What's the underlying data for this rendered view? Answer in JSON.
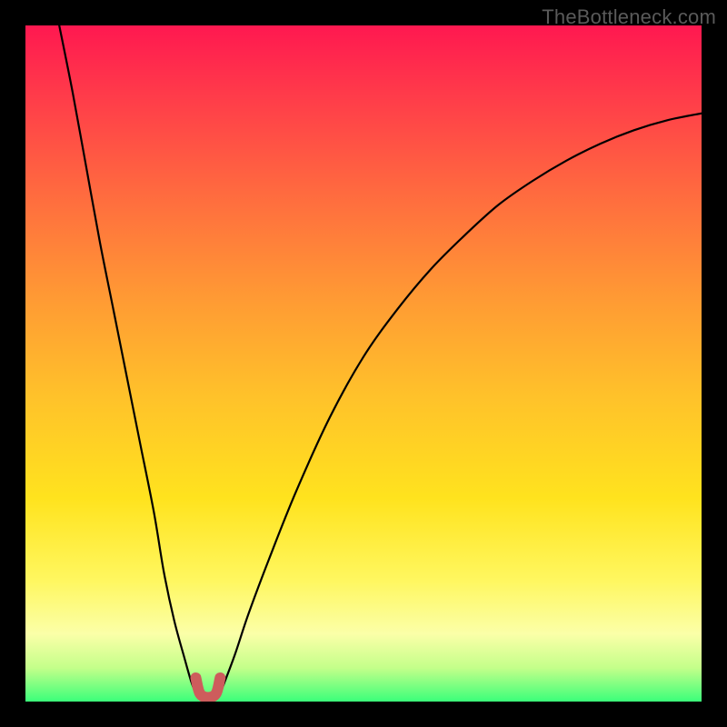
{
  "watermark": "TheBottleneck.com",
  "palette": {
    "frame": "#000000",
    "curve_stroke": "#000000",
    "marker_stroke": "#cd5c5c",
    "gradient_top": "#ff1850",
    "gradient_bottom": "#3bff7a"
  },
  "chart_data": {
    "type": "line",
    "title": "",
    "xlabel": "",
    "ylabel": "",
    "xlim": [
      0,
      100
    ],
    "ylim": [
      0,
      100
    ],
    "series": [
      {
        "name": "left-branch",
        "x": [
          5,
          7,
          9,
          11,
          13,
          15,
          17,
          19,
          20.5,
          22,
          23.5,
          24.5,
          25.2
        ],
        "values": [
          100,
          90,
          79,
          68,
          58,
          48,
          38,
          28,
          19,
          12,
          6.5,
          3,
          1.2
        ]
      },
      {
        "name": "right-branch",
        "x": [
          28.8,
          29.5,
          31,
          33,
          36,
          40,
          45,
          50,
          55,
          60,
          65,
          70,
          75,
          80,
          85,
          90,
          95,
          100
        ],
        "values": [
          1.2,
          3,
          7,
          13,
          21,
          31,
          42,
          51,
          58,
          64,
          69,
          73.5,
          77,
          80,
          82.5,
          84.5,
          86,
          87
        ]
      },
      {
        "name": "trough-marker",
        "x": [
          25.2,
          25.8,
          27,
          28.2,
          28.8
        ],
        "values": [
          3.5,
          1.2,
          0.6,
          1.2,
          3.5
        ]
      }
    ],
    "annotations": [],
    "legend": null,
    "grid": false
  }
}
